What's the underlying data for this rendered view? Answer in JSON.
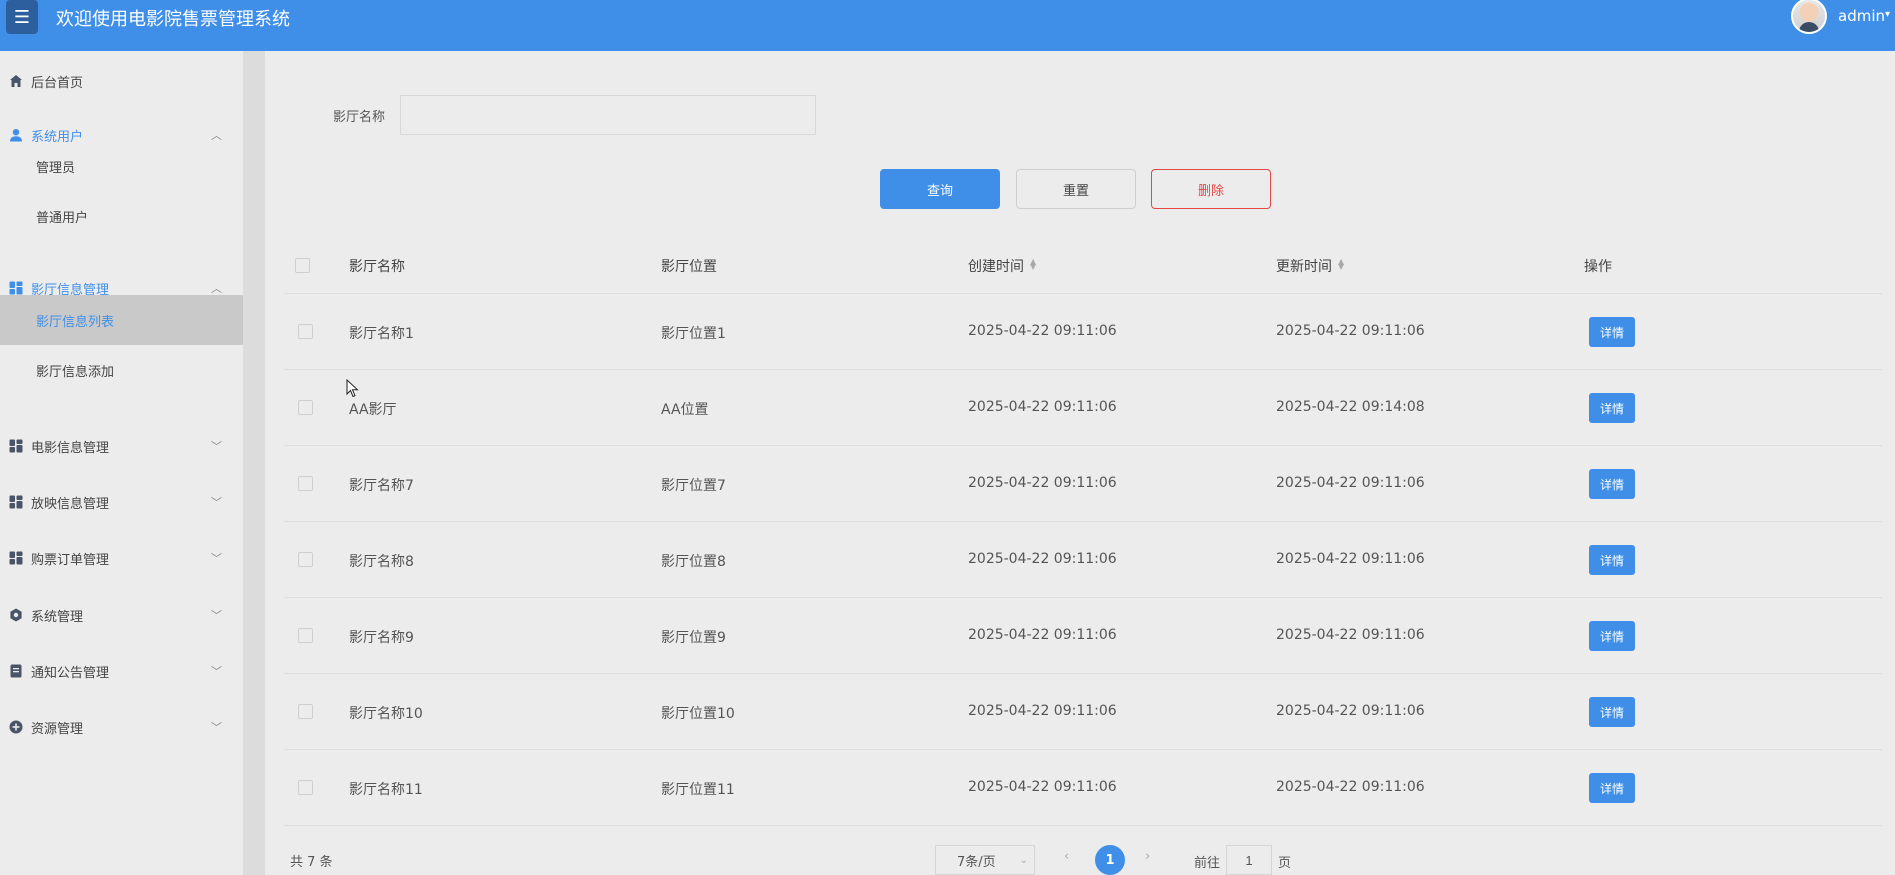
{
  "header": {
    "menu_icon": "hamburger-icon",
    "title": "欢迎使用电影院售票管理系统",
    "user": "admin"
  },
  "sidebar": {
    "items": [
      {
        "label": "后台首页",
        "icon": "home-icon"
      },
      {
        "label": "系统用户",
        "icon": "user-icon",
        "expanded": true,
        "children": [
          {
            "label": "管理员"
          },
          {
            "label": "普通用户"
          }
        ]
      },
      {
        "label": "影厅信息管理",
        "icon": "grid-icon",
        "expanded": true,
        "children": [
          {
            "label": "影厅信息列表",
            "active": true
          },
          {
            "label": "影厅信息添加"
          }
        ]
      },
      {
        "label": "电影信息管理",
        "icon": "grid-icon"
      },
      {
        "label": "放映信息管理",
        "icon": "grid-icon"
      },
      {
        "label": "购票订单管理",
        "icon": "grid-icon"
      },
      {
        "label": "系统管理",
        "icon": "gear-icon"
      },
      {
        "label": "通知公告管理",
        "icon": "document-icon"
      },
      {
        "label": "资源管理",
        "icon": "plus-circle-icon"
      }
    ]
  },
  "filter": {
    "label": "影厅名称",
    "value": ""
  },
  "actions": {
    "query": "查询",
    "reset": "重置",
    "delete": "删除"
  },
  "table": {
    "columns": [
      "影厅名称",
      "影厅位置",
      "创建时间",
      "更新时间",
      "操作"
    ],
    "detail_label": "详情",
    "rows": [
      {
        "name": "影厅名称1",
        "location": "影厅位置1",
        "created": "2025-04-22 09:11:06",
        "updated": "2025-04-22 09:11:06"
      },
      {
        "name": "AA影厅",
        "location": "AA位置",
        "created": "2025-04-22 09:11:06",
        "updated": "2025-04-22 09:14:08"
      },
      {
        "name": "影厅名称7",
        "location": "影厅位置7",
        "created": "2025-04-22 09:11:06",
        "updated": "2025-04-22 09:11:06"
      },
      {
        "name": "影厅名称8",
        "location": "影厅位置8",
        "created": "2025-04-22 09:11:06",
        "updated": "2025-04-22 09:11:06"
      },
      {
        "name": "影厅名称9",
        "location": "影厅位置9",
        "created": "2025-04-22 09:11:06",
        "updated": "2025-04-22 09:11:06"
      },
      {
        "name": "影厅名称10",
        "location": "影厅位置10",
        "created": "2025-04-22 09:11:06",
        "updated": "2025-04-22 09:11:06"
      },
      {
        "name": "影厅名称11",
        "location": "影厅位置11",
        "created": "2025-04-22 09:11:06",
        "updated": "2025-04-22 09:11:06"
      }
    ]
  },
  "pagination": {
    "total": "共 7 条",
    "page_size": "7条/页",
    "current_page": "1",
    "goto_label": "前往",
    "goto_value": "1",
    "goto_suffix": "页"
  },
  "colors": {
    "primary": "#3f8fe8",
    "danger": "#e64545"
  }
}
